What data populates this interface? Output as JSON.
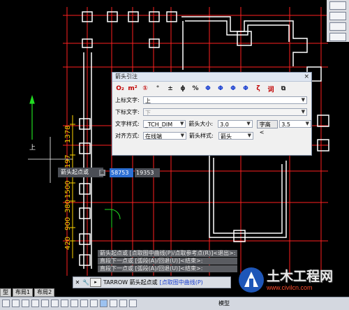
{
  "drawing": {
    "dimensions": [
      "1378",
      "1197",
      "1500",
      "380",
      "900",
      "420"
    ],
    "text_up": "上"
  },
  "dialog": {
    "title": "箭头引注",
    "close_label": "×",
    "symbols": [
      "O₂",
      "m²",
      "①",
      "°",
      "±",
      "ϕ",
      "%",
      "Φ",
      "Φ",
      "Φ",
      "Φ",
      "ζ",
      "词",
      "⧉"
    ],
    "upper_text_label": "上标文字:",
    "upper_text_value": "上",
    "lower_text_label": "下标文字:",
    "lower_text_value": "下",
    "text_style_label": "文字样式:",
    "text_style_value": "_TCH_DIM",
    "arrow_size_label": "箭头大小:",
    "arrow_size_value": "3.0",
    "char_height_button": "字高<",
    "char_height_value": "3.5",
    "align_label": "对齐方式:",
    "align_value": "在线端",
    "arrow_style_label": "箭头样式:",
    "arrow_style_value": "箭头"
  },
  "cursor_tip": {
    "label": "箭头起点或",
    "icon": "⊞",
    "x_value": "58753",
    "y_value": "19353"
  },
  "history": [
    "箭头起点或 [点取图中曲线(P)/点取参考点(R)]<退出>:",
    "直段下一点或 [弧段(A)/回退(U)]<结束>:",
    "直段下一点或 [弧段(A)/回退(U)]<结束>:"
  ],
  "command_line": {
    "close_label": "✕",
    "wrench_icon": "wrench-icon",
    "text": "TARROW 箭头起点或",
    "option": "[点取图中曲线(P)"
  },
  "tabs": [
    "型",
    "布局1",
    "布局2"
  ],
  "status": {
    "right_text": "模型"
  },
  "watermark": {
    "title": "土木工程网",
    "url": "www.civilcn.com"
  },
  "colors": {
    "grid_red": "#ff2020",
    "outline_white": "#ffffff",
    "dim_yellow": "#ffd400",
    "axis_green": "#22dd22",
    "highlight_blue": "#2d6fd2"
  }
}
